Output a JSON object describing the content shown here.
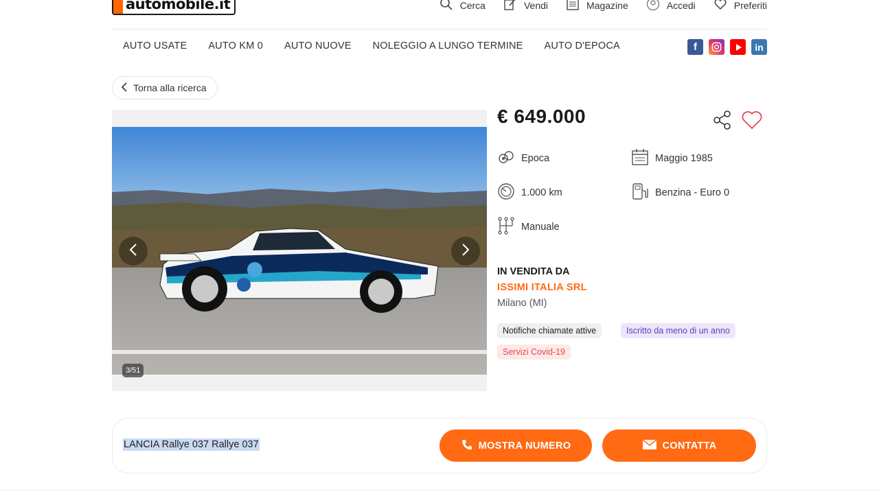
{
  "header": {
    "logo_text": "automobile.it",
    "top_nav": [
      {
        "label": "Cerca",
        "icon": "search-icon"
      },
      {
        "label": "Vendi",
        "icon": "edit-icon"
      },
      {
        "label": "Magazine",
        "icon": "newspaper-icon"
      },
      {
        "label": "Accedi",
        "icon": "user-icon"
      },
      {
        "label": "Preferiti",
        "icon": "heart-icon"
      }
    ],
    "categories": [
      "AUTO USATE",
      "AUTO KM 0",
      "AUTO NUOVE",
      "NOLEGGIO A LUNGO TERMINE",
      "AUTO D'EPOCA"
    ],
    "social": [
      "facebook-icon",
      "instagram-icon",
      "youtube-icon",
      "linkedin-icon"
    ]
  },
  "back_button": {
    "label": "Torna alla ricerca"
  },
  "gallery": {
    "counter": "3/51"
  },
  "listing": {
    "price": "€ 649.000",
    "specs": {
      "category": "Epoca",
      "date": "Maggio 1985",
      "mileage": "1.000 km",
      "fuel": "Benzina - Euro 0",
      "transmission": "Manuale"
    },
    "seller_heading": "IN VENDITA DA",
    "seller_name": "ISSIMI ITALIA SRL",
    "seller_location": "Milano (MI)",
    "badges": {
      "calls": "Notifiche chiamate attive",
      "new": "Iscritto da meno di un anno",
      "covid": "Servizi Covid-19"
    }
  },
  "bottom_bar": {
    "title": "LANCIA Rallye 037 Rallye 037",
    "show_number": "MOSTRA NUMERO",
    "contact": "CONTATTA"
  },
  "colors": {
    "accent": "#ff6a13",
    "badge_gray": "#efefef",
    "badge_purple": "#ece6fb",
    "badge_red": "#fde9e7"
  }
}
